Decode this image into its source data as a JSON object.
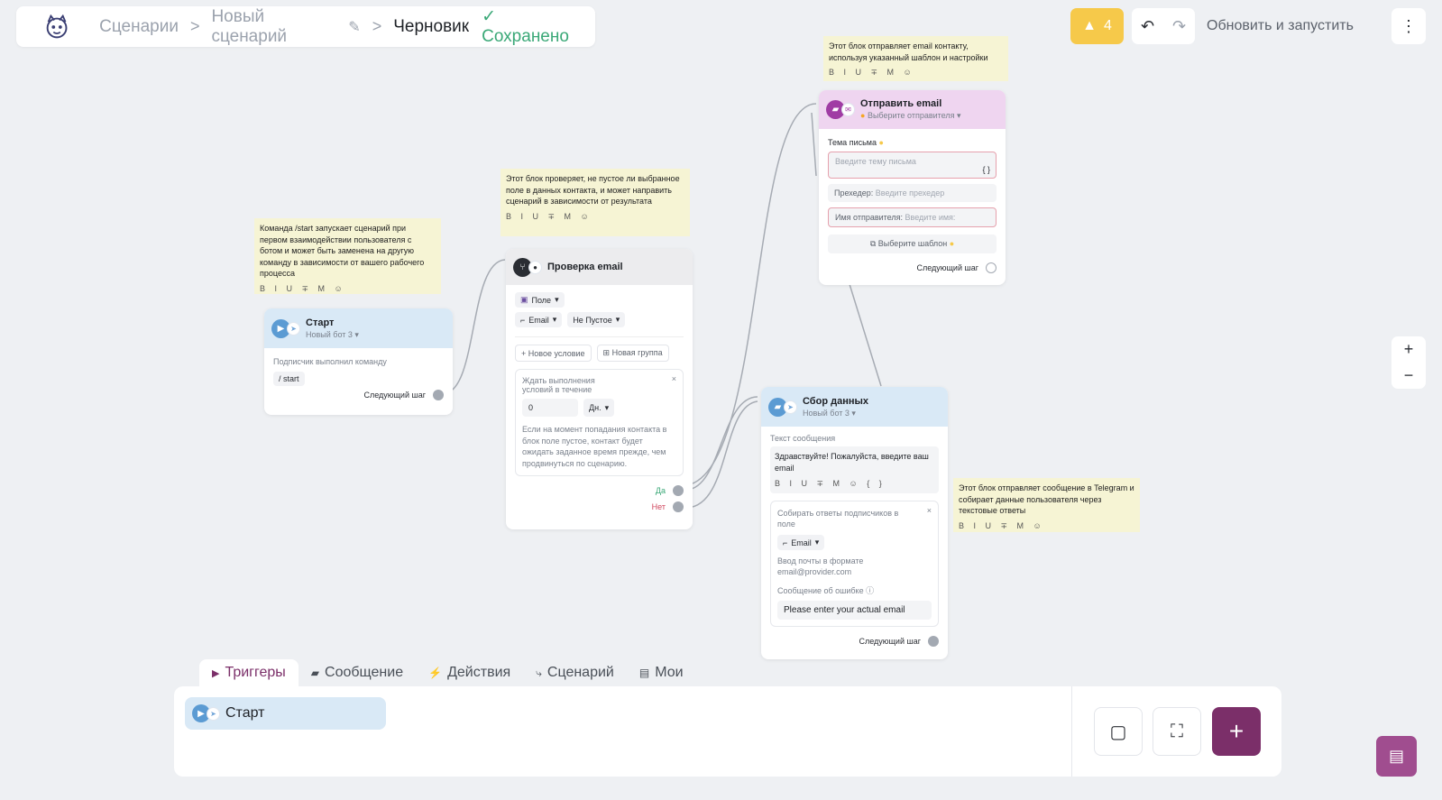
{
  "colors": {
    "accent": "#7b2f69",
    "warning": "#f6c94a",
    "saved": "#3aa877",
    "note_bg": "#f6f4d4"
  },
  "header": {
    "crumb_scenarios": "Сценарии",
    "crumb_new": "Новый сценарий",
    "crumb_sep": ">",
    "pencil_icon": "✎",
    "status_draft": "Черновик",
    "status_saved": "Сохранено",
    "saved_check": "✓",
    "warnings_count": "4",
    "warning_icon": "▲",
    "undo_icon": "↶",
    "redo_icon": "↷",
    "update_label": "Обновить и запустить",
    "more_icon": "⋮"
  },
  "format_tools": "B I U ∓ M ☺",
  "notes": {
    "start": "Команда /start запускает сценарий при первом взаимодействии пользователя с ботом и может быть заменена на другую команду в зависимости от вашего рабочего процесса",
    "check": "Этот блок проверяет, не пустое ли выбранное поле в данных контакта, и может направить сценарий в зависимости от результата",
    "email": "Этот блок отправляет email контакту, используя указанный шаблон и настройки",
    "collect": "Этот блок отправляет сообщение в Telegram и собирает данные пользователя через текстовые ответы"
  },
  "nodes": {
    "start": {
      "title": "Старт",
      "bot": "Новый бот 3",
      "trigger_label": "Подписчик выполнил команду",
      "command": "/ start",
      "next_step": "Следующий шаг"
    },
    "check": {
      "title": "Проверка email",
      "field_label": "Поле",
      "field_value": "Email",
      "condition": "Не Пустое",
      "new_condition": "+ Новое условие",
      "new_group": "⊞ Новая группа",
      "wait_label": "Ждать выполнения условий в течение",
      "wait_value": "0",
      "wait_unit": "Дн.",
      "wait_hint": "Если на момент попадания контакта в блок поле пустое, контакт будет ожидать заданное время прежде, чем продвинуться по сценарию.",
      "yes": "Да",
      "no": "Нет"
    },
    "email": {
      "title": "Отправить email",
      "sender_select": "Выберите отправителя",
      "subject_label": "Тема письма",
      "subject_placeholder": "Введите тему письма",
      "braces": "{ }",
      "preheader_label": "Прехедер:",
      "preheader_placeholder": "Введите прехедер",
      "sender_name_label": "Имя отправителя:",
      "sender_name_placeholder": "Введите имя:",
      "template_btn": "⧉ Выберите шаблон",
      "next_step": "Следующий шаг"
    },
    "collect": {
      "title": "Сбор данных",
      "bot": "Новый бот 3",
      "message_label": "Текст сообщения",
      "message_text": "Здравствуйте! Пожалуйста, введите ваш email",
      "collect_label": "Собирать ответы подписчиков в поле",
      "collect_field": "Email",
      "input_hint": "Ввод почты в формате email@provider.com",
      "error_label": "Сообщение об ошибке",
      "error_value": "Please enter your actual email",
      "next_step": "Следующий шаг"
    }
  },
  "bottom": {
    "tabs": [
      {
        "label": "Триггеры",
        "icon": "▶"
      },
      {
        "label": "Сообщение",
        "icon": "▰"
      },
      {
        "label": "Действия",
        "icon": "⚡"
      },
      {
        "label": "Сценарий",
        "icon": "⤷"
      },
      {
        "label": "Мои",
        "icon": "▤"
      }
    ],
    "start_item": "Старт",
    "comment_icon": "▢",
    "expand_icon": "⛶",
    "add_icon": "+",
    "chat_icon": "▤",
    "zoom_in": "+",
    "zoom_out": "−"
  }
}
